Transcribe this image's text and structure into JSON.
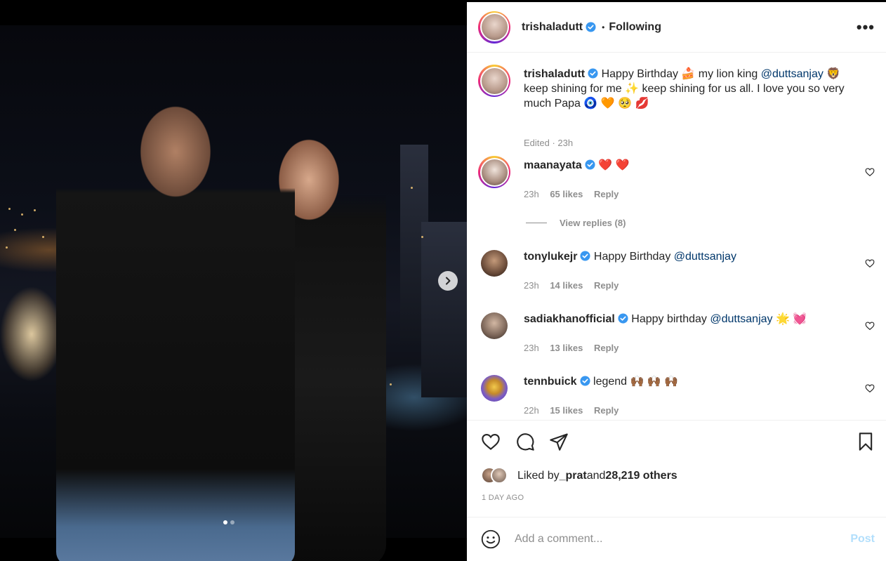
{
  "post": {
    "author": "trishaladutt",
    "follow_status": "Following",
    "more": "•••",
    "caption_prefix": "Happy Birthday 🍰 my lion king ",
    "caption_mention": "@duttsanjay",
    "caption_suffix": " 🦁 keep shining for me ✨ keep shining for us all. I love you so very much Papa 🧿 🧡 🥺 💋",
    "caption_meta": "Edited · 23h"
  },
  "comments": [
    {
      "user": "maanayata",
      "text": "❤️ ❤️",
      "mention": "",
      "trail": "",
      "time": "23h",
      "likes": "65 likes",
      "reply": "Reply",
      "view_replies": "View replies (8)"
    },
    {
      "user": "tonylukejr",
      "text": "Happy Birthday ",
      "mention": "@duttsanjay",
      "trail": "",
      "time": "23h",
      "likes": "14 likes",
      "reply": "Reply"
    },
    {
      "user": "sadiakhanofficial",
      "text": "Happy birthday ",
      "mention": "@duttsanjay",
      "trail": " 🌟 💓",
      "time": "23h",
      "likes": "13 likes",
      "reply": "Reply"
    },
    {
      "user": "tennbuick",
      "text": "legend 🙌🏾 🙌🏾 🙌🏾",
      "mention": "",
      "trail": "",
      "time": "22h",
      "likes": "15 likes",
      "reply": "Reply"
    }
  ],
  "likes": {
    "prefix": "Liked by ",
    "user": "_prat",
    "middle": " and ",
    "others": "28,219 others"
  },
  "time_ago": "1 DAY AGO",
  "comment_box": {
    "placeholder": "Add a comment...",
    "post_label": "Post"
  },
  "carousel": {
    "current": 1,
    "total": 2
  },
  "colors": {
    "verified": "#3897f0",
    "mention": "#00376b",
    "post_disabled": "#b2dffc"
  },
  "icons": [
    "chevron-right-icon",
    "verified-icon",
    "heart-icon",
    "comment-icon",
    "share-icon",
    "bookmark-icon",
    "emoji-icon",
    "more-icon"
  ]
}
